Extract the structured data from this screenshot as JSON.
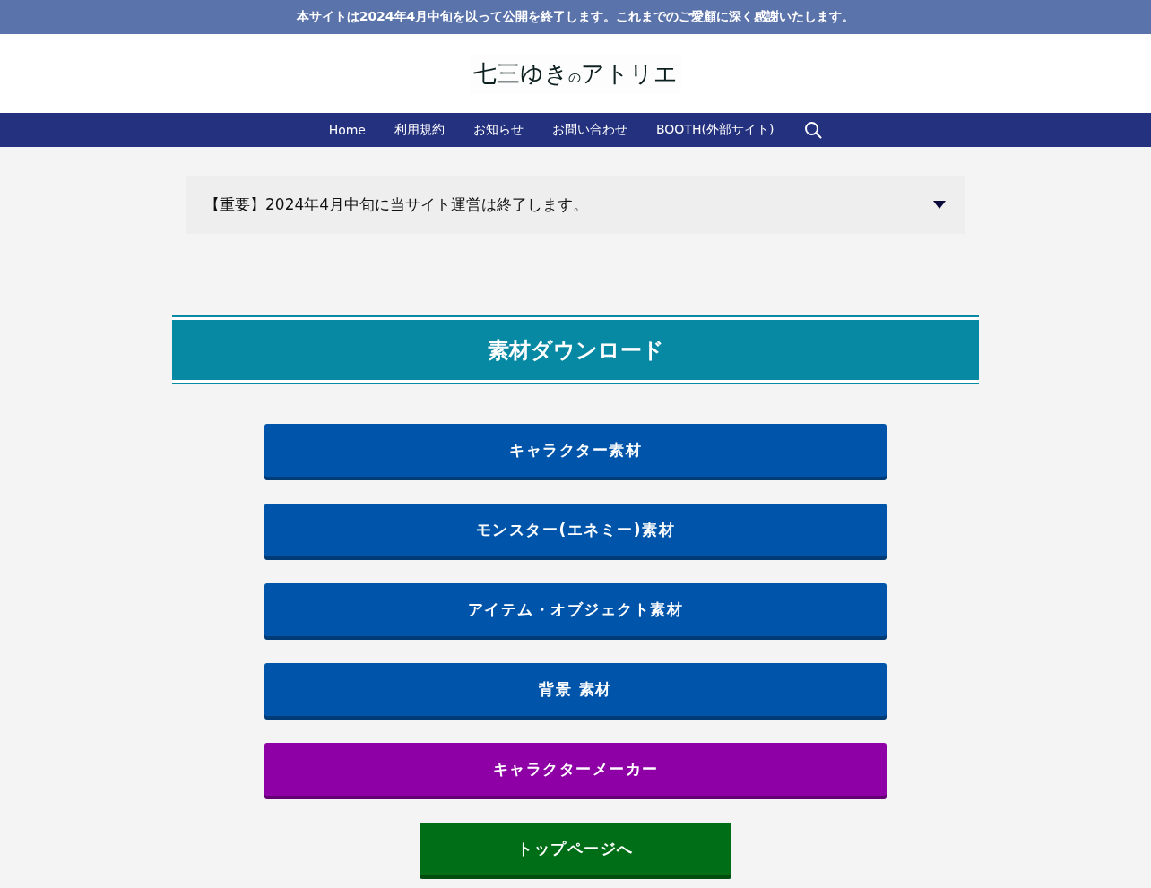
{
  "notice_bar": {
    "text": "本サイトは2024年4月中旬を以って公開を終了します。これまでのご愛顧に深く感謝いたします。"
  },
  "logo": {
    "text": "七三ゆき$_{の}$アトリエ"
  },
  "nav": {
    "items": [
      {
        "label": "Home"
      },
      {
        "label": "利用規約"
      },
      {
        "label": "お知らせ"
      },
      {
        "label": "お問い合わせ"
      },
      {
        "label": "BOOTH(外部サイト)"
      }
    ]
  },
  "accordion": {
    "title": "【重要】2024年4月中旬に当サイト運営は終了します。",
    "expanded": false
  },
  "section_heading": "素材ダウンロード",
  "buttons": [
    {
      "label": "キャラクター素材",
      "color": "#0055aa"
    },
    {
      "label": "モンスター(エネミー)素材",
      "color": "#0055aa"
    },
    {
      "label": "アイテム・オブジェクト素材",
      "color": "#0055aa"
    },
    {
      "label": "背景 素材",
      "color": "#0055aa"
    },
    {
      "label": "キャラクターメーカー",
      "color": "#8e00a5"
    }
  ],
  "top_page_button": {
    "label": "トップページへ",
    "color": "#006e16"
  }
}
